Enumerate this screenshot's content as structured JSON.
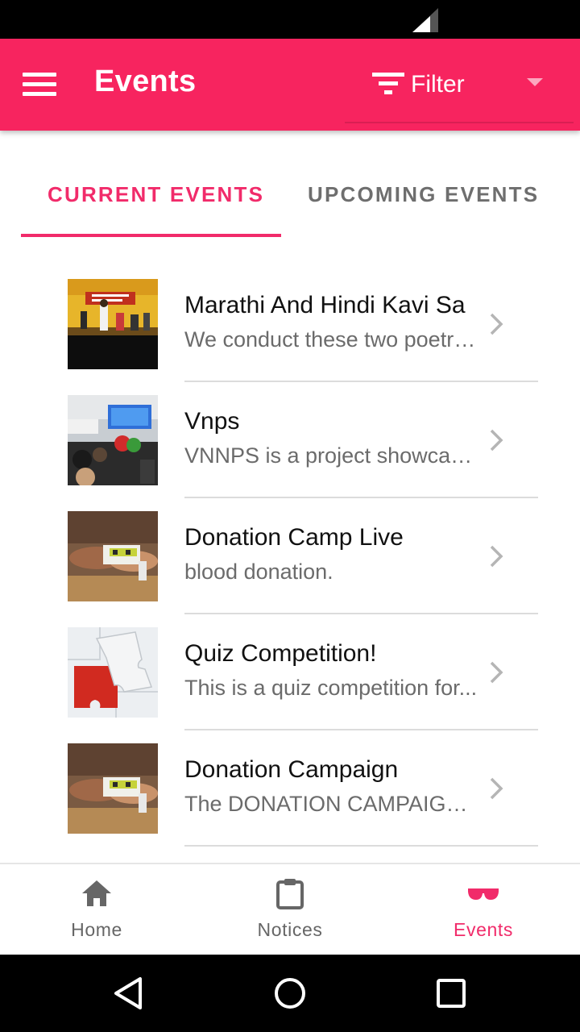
{
  "app_bar": {
    "title": "Events",
    "filter_label": "Filter"
  },
  "tabs": [
    {
      "label": "CURRENT EVENTS",
      "active": true
    },
    {
      "label": "UPCOMING EVENTS",
      "active": false
    }
  ],
  "events": [
    {
      "title": "Marathi And Hindi Kavi Sa",
      "description": "We conduct these two poetry sessions...",
      "thumbnail": "kavi-sammelan-stage-photo"
    },
    {
      "title": "Vnps",
      "description": "VNNPS is a project showcase...",
      "thumbnail": "audience-presentation-photo"
    },
    {
      "title": "Donation Camp Live",
      "description": "blood donation.",
      "thumbnail": "hands-donation-photo"
    },
    {
      "title": "Quiz Competition!",
      "description": "This is a quiz competition for...",
      "thumbnail": "puzzle-question-answer-photo"
    },
    {
      "title": "Donation Campaign",
      "description": "The DONATION CAMPAIGN ...",
      "thumbnail": "hands-donation-photo"
    }
  ],
  "bottom_nav": [
    {
      "label": "Home",
      "icon": "home-icon",
      "active": false
    },
    {
      "label": "Notices",
      "icon": "clipboard-icon",
      "active": false
    },
    {
      "label": "Events",
      "icon": "glasses-icon",
      "active": true
    }
  ],
  "colors": {
    "primary": "#f7245f",
    "accent": "#f12b6a",
    "inactive_text": "#666666"
  }
}
